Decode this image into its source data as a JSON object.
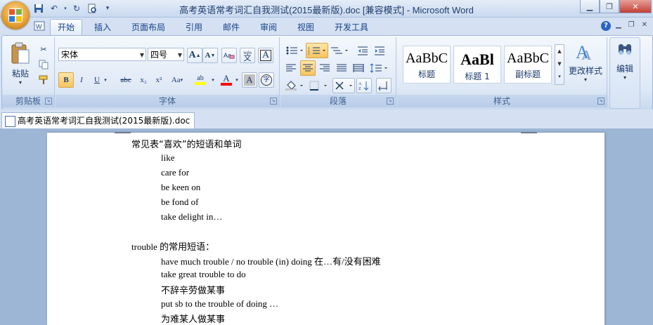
{
  "window": {
    "title": "高考英语常考词汇自我测试(2015最新版).doc [兼容模式] - Microsoft Word",
    "controls": [
      "minimize-icon",
      "restore-icon",
      "close-icon"
    ]
  },
  "quick_access": [
    "save-icon",
    "undo-icon",
    "redo-icon",
    "print-preview-icon",
    "customize-icon"
  ],
  "tabs": [
    "开始",
    "插入",
    "页面布局",
    "引用",
    "邮件",
    "审阅",
    "视图",
    "开发工具"
  ],
  "active_tab": "开始",
  "ribbon": {
    "clipboard": {
      "label": "剪贴板",
      "paste_label": "粘贴"
    },
    "font": {
      "label": "字体",
      "font_name": "宋体",
      "font_size": "四号",
      "grow_label": "A",
      "shrink_label": "A",
      "phonetic_label": "wén",
      "phonetic_char": "文",
      "border_label": "A",
      "bold": "B",
      "italic": "I",
      "underline": "U",
      "strike": "abc",
      "subscript": "x₂",
      "superscript": "x²",
      "case": "Aa",
      "highlight": "ab",
      "color": "A",
      "shade": "A",
      "enclose": "字",
      "highlight_color": "#ffff00",
      "font_color": "#ff0000"
    },
    "paragraph": {
      "label": "段落"
    },
    "styles": {
      "label": "样式",
      "items": [
        {
          "sample": "AaBbC",
          "name": "标题"
        },
        {
          "sample": "AaBl",
          "name": "标题 1"
        },
        {
          "sample": "AaBbC",
          "name": "副标题"
        }
      ],
      "change_label": "更改样式"
    },
    "editing": {
      "label": "编辑"
    }
  },
  "document_tab": "高考英语常考词汇自我测试(2015最新版).doc",
  "document": {
    "lines": [
      {
        "text": "常见表“喜欢”的短语和单词",
        "indent": 0
      },
      {
        "text": "like",
        "indent": 1
      },
      {
        "text": "care for",
        "indent": 1
      },
      {
        "text": "be keen on",
        "indent": 1
      },
      {
        "text": "be fond of",
        "indent": 1
      },
      {
        "text": "take delight in…",
        "indent": 1
      },
      {
        "text": "",
        "indent": 0
      },
      {
        "text": "trouble 的常用短语：",
        "indent": 0
      },
      {
        "text": "have much trouble / no trouble (in) doing  在…有/没有困难",
        "indent": 1
      },
      {
        "text": "take great trouble to do",
        "indent": 1
      },
      {
        "text": "不辞辛劳做某事",
        "indent": 1
      },
      {
        "text": "put sb to the trouble of doing …",
        "indent": 1
      },
      {
        "text": "为难某人做某事",
        "indent": 1
      }
    ]
  }
}
